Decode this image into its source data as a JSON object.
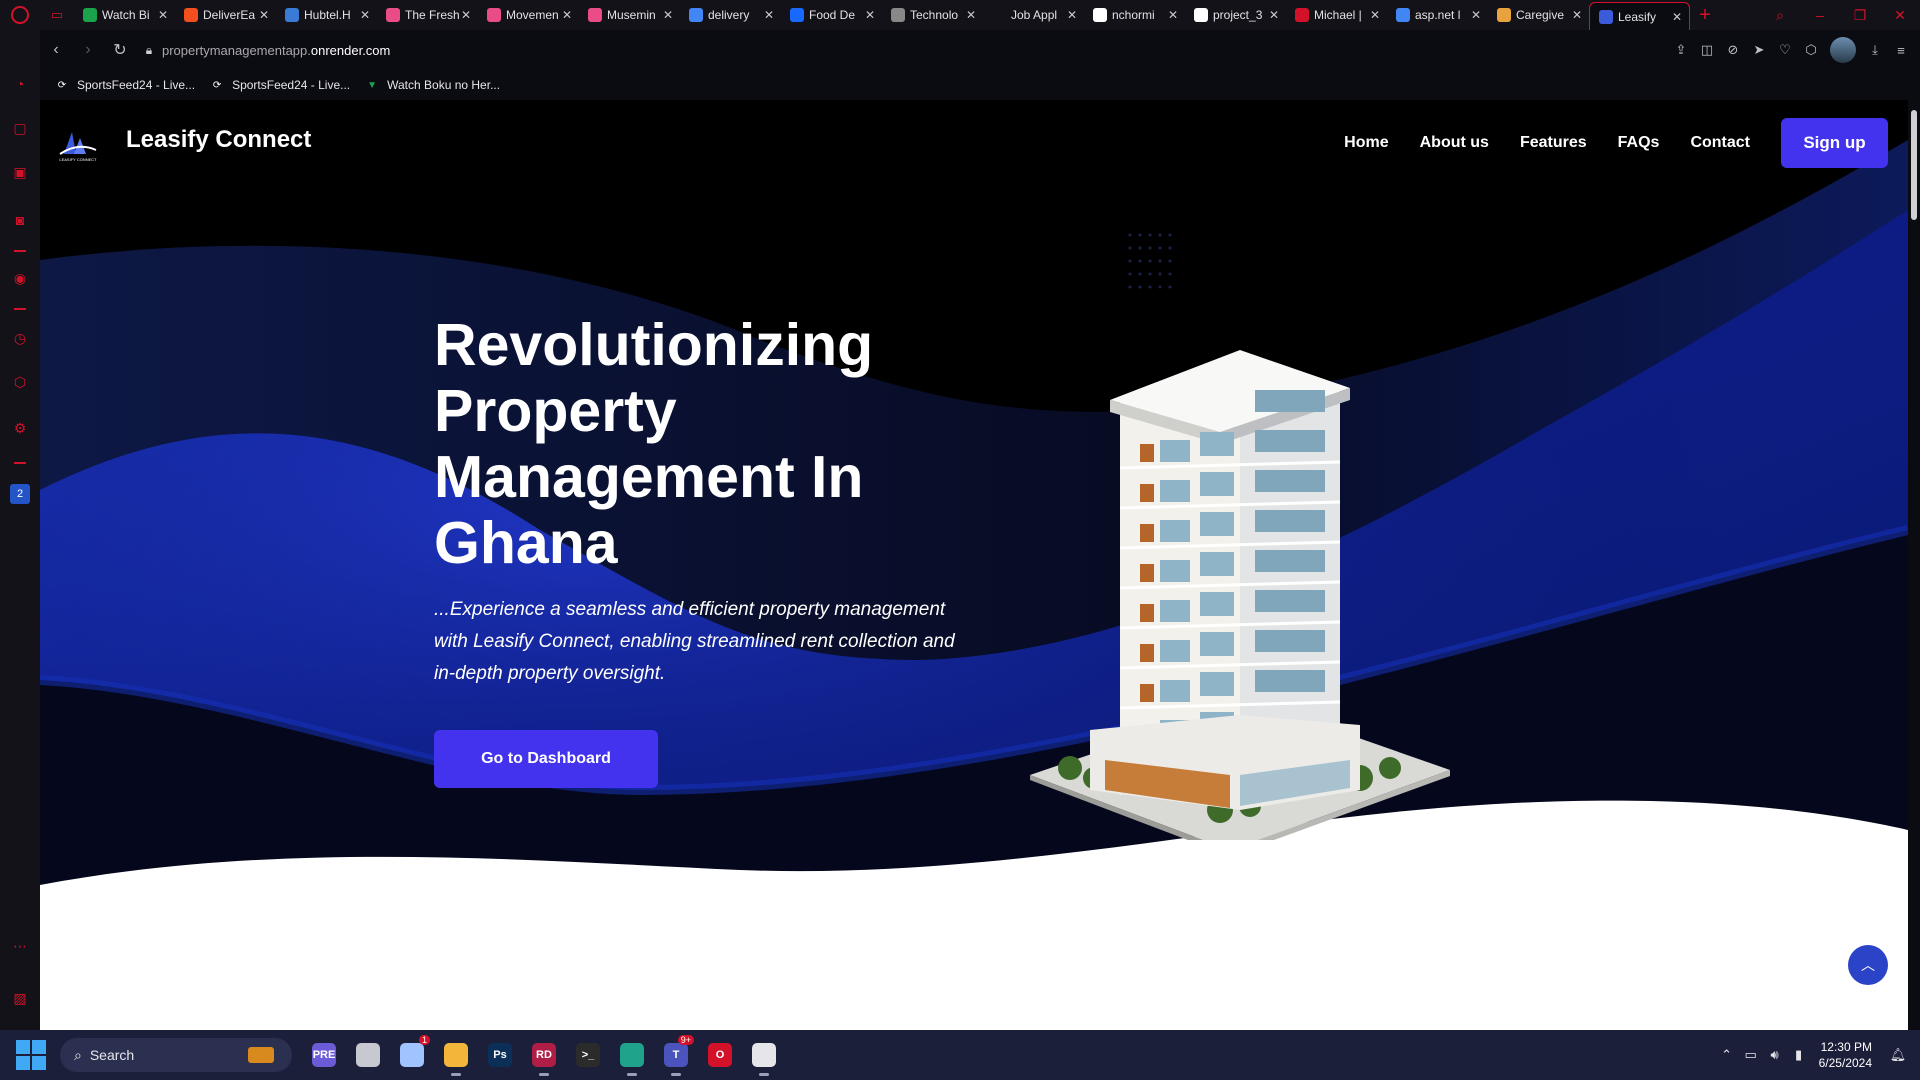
{
  "browser": {
    "tabs": [
      {
        "title": "Watch Bi",
        "favicon_color": "#1aa34a"
      },
      {
        "title": "DeliverEa",
        "favicon_color": "#f24e1e"
      },
      {
        "title": "Hubtel.H",
        "favicon_color": "#3a7bd5"
      },
      {
        "title": "The Fresh",
        "favicon_color": "#ea4c89"
      },
      {
        "title": "Movemen",
        "favicon_color": "#ea4c89"
      },
      {
        "title": "Musemin",
        "favicon_color": "#ea4c89"
      },
      {
        "title": "delivery",
        "favicon_color": "#4285f4"
      },
      {
        "title": "Food De",
        "favicon_color": "#1769ff"
      },
      {
        "title": "Technolo",
        "favicon_color": "#888888"
      },
      {
        "title": "Job Appl",
        "favicon_color": "#121218"
      },
      {
        "title": "nchormi",
        "favicon_color": "#ffffff"
      },
      {
        "title": "project_3",
        "favicon_color": "#ffffff"
      },
      {
        "title": "Michael |",
        "favicon_color": "#d3122a"
      },
      {
        "title": "asp.net l",
        "favicon_color": "#4285f4"
      },
      {
        "title": "Caregive",
        "favicon_color": "#e8a33d"
      },
      {
        "title": "Leasify",
        "favicon_color": "#3b5bdb",
        "active": true
      }
    ],
    "new_tab_label": "+",
    "url_prefix": "propertymanagementapp.",
    "url_domain": "onrender.com",
    "bookmarks": [
      {
        "label": "SportsFeed24 - Live..."
      },
      {
        "label": "SportsFeed24 - Live..."
      },
      {
        "label": "Watch Boku no Her..."
      }
    ],
    "accent": "#d3122a"
  },
  "site": {
    "brand": "Leasify Connect",
    "logo_text": "LEASIFY CONNECT",
    "nav": [
      "Home",
      "About us",
      "Features",
      "FAQs",
      "Contact"
    ],
    "signup_label": "Sign up",
    "hero_title": "Revolutionizing Property Management In Ghana",
    "hero_text": "...Experience a seamless and efficient property management with Leasify Connect, enabling streamlined rent collection and in-depth property oversight.",
    "cta_label": "Go to Dashboard",
    "accent": "#4433ee",
    "scroll_top_icon": "chevron-up-icon"
  },
  "taskbar": {
    "search_placeholder": "Search",
    "time": "12:30 PM",
    "date": "6/25/2024",
    "apps": [
      {
        "name": "copilot",
        "label": "PRE",
        "color": "#6b5bd6"
      },
      {
        "name": "file-viewer",
        "label": "",
        "color": "#c8c8d0"
      },
      {
        "name": "weather",
        "label": "",
        "color": "#9fc4ff",
        "badge": "1"
      },
      {
        "name": "file-explorer",
        "label": "",
        "color": "#f2b73a"
      },
      {
        "name": "photoshop",
        "label": "Ps",
        "color": "#0b2f57"
      },
      {
        "name": "rider",
        "label": "RD",
        "color": "#b01d45"
      },
      {
        "name": "terminal",
        "label": ">_",
        "color": "#2b2b2b"
      },
      {
        "name": "edge",
        "label": "",
        "color": "#1fa38a"
      },
      {
        "name": "teams",
        "label": "T",
        "color": "#4b53bc",
        "badge": "9+"
      },
      {
        "name": "opera",
        "label": "O",
        "color": "#d3122a"
      },
      {
        "name": "chrome-alt",
        "label": "",
        "color": "#e6e6ea"
      }
    ]
  }
}
